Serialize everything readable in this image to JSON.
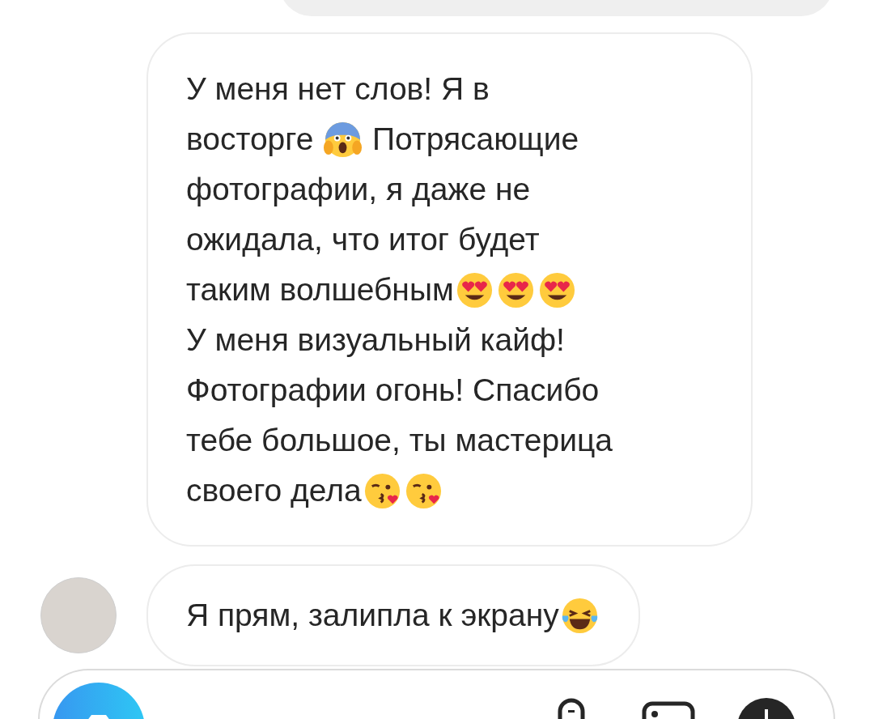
{
  "messages": [
    {
      "avatar": false,
      "lines": [
        [
          {
            "kind": "text",
            "text": "У меня нет слов! Я в"
          }
        ],
        [
          {
            "kind": "text",
            "text": "восторге "
          },
          {
            "kind": "scream"
          },
          {
            "kind": "text",
            "text": " Потрясающие"
          }
        ],
        [
          {
            "kind": "text",
            "text": "фотографии, я даже не"
          }
        ],
        [
          {
            "kind": "text",
            "text": "ожидала, что итог будет"
          }
        ],
        [
          {
            "kind": "text",
            "text": "таким волшебным"
          },
          {
            "kind": "hearteyes"
          },
          {
            "kind": "hearteyes"
          },
          {
            "kind": "hearteyes"
          }
        ],
        [
          {
            "kind": "text",
            "text": "У меня визуальный кайф!"
          }
        ],
        [
          {
            "kind": "text",
            "text": "Фотографии огонь! Спасибо"
          }
        ],
        [
          {
            "kind": "text",
            "text": "тебе большое, ты мастерица"
          }
        ],
        [
          {
            "kind": "text",
            "text": "своего дела"
          },
          {
            "kind": "kiss"
          },
          {
            "kind": "kiss"
          }
        ]
      ]
    },
    {
      "avatar": true,
      "lines": [
        [
          {
            "kind": "text",
            "text": "Я прям, залипла к экрану"
          },
          {
            "kind": "laugh"
          }
        ]
      ]
    }
  ]
}
